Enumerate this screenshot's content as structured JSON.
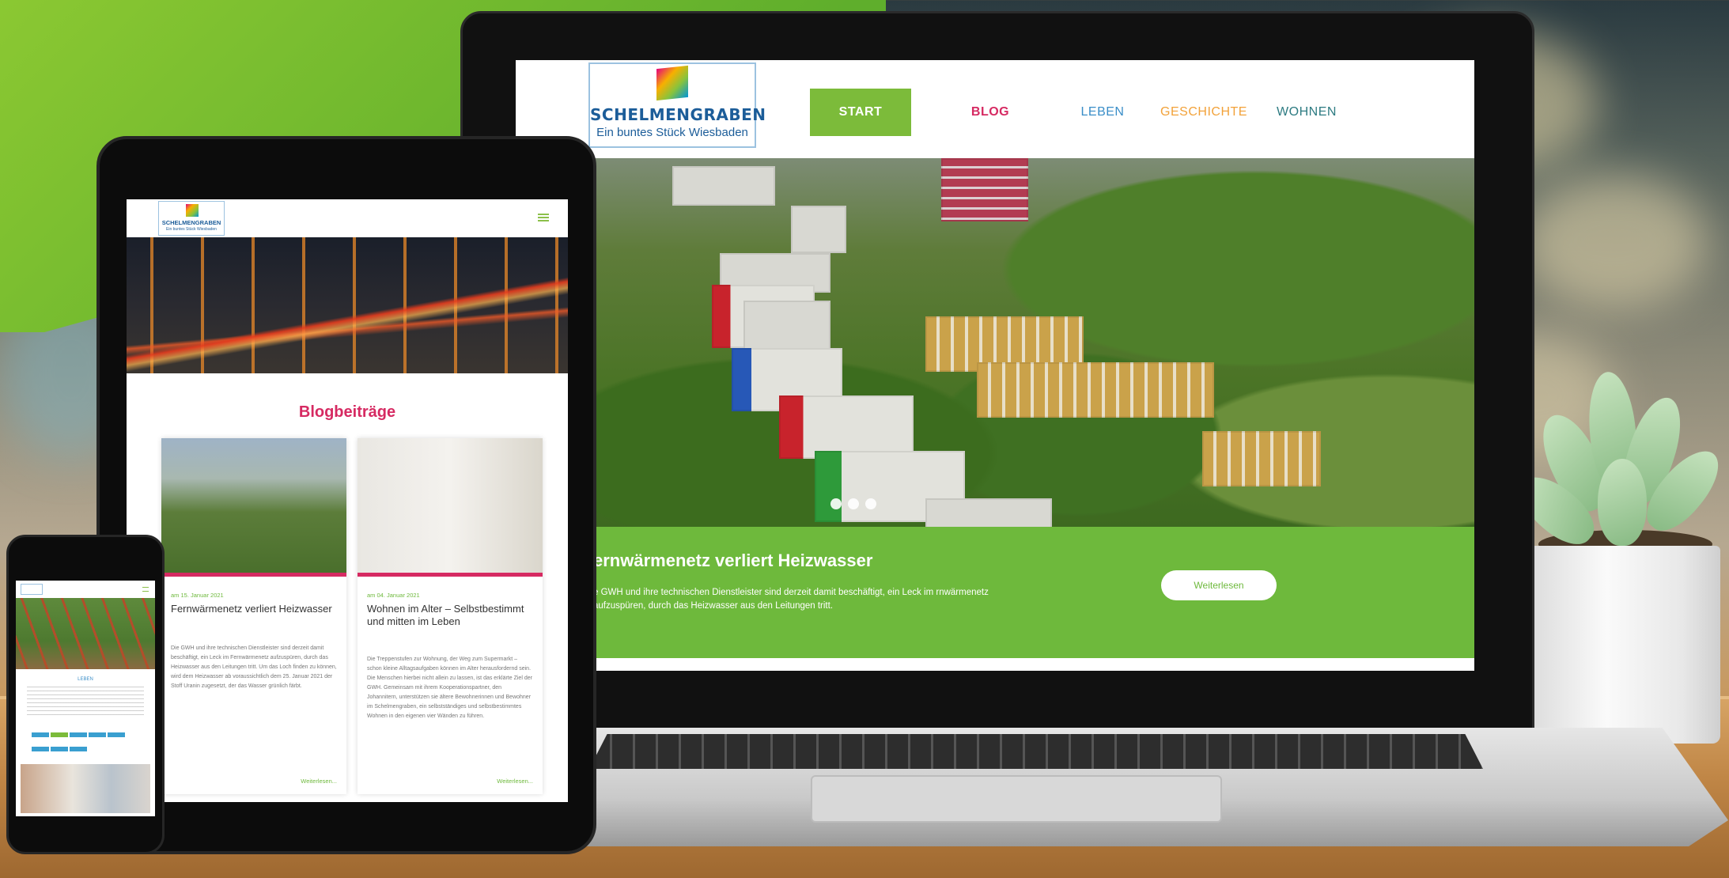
{
  "site": {
    "logo_title": "SCHELMENGRABEN",
    "logo_subtitle": "Ein buntes Stück Wiesbaden"
  },
  "nav": {
    "items": [
      {
        "label": "START",
        "color": "#7cbb3a"
      },
      {
        "label": "BLOG",
        "color": "#d62a62"
      },
      {
        "label": "LEBEN",
        "color": "#3a8ec8"
      },
      {
        "label": "GESCHICHTE",
        "color": "#f2a23a"
      },
      {
        "label": "WOHNEN",
        "color": "#2d7b82"
      }
    ]
  },
  "hero": {
    "title": "ernwärmenetz verliert Heizwasser",
    "text": "e GWH und ihre technischen Dienstleister sind derzeit damit beschäftigt, ein Leck im rnwärmenetz aufzuspüren, durch das Heizwasser aus den Leitungen tritt.",
    "button": "Weiterlesen"
  },
  "tablet": {
    "heading": "Blogbeiträge",
    "cards": [
      {
        "date": "am 15. Januar 2021",
        "title": "Fernwärmenetz verliert Heizwasser",
        "text": "Die GWH und ihre technischen Dienstleister sind derzeit damit beschäftigt, ein Leck im Fernwärmenetz aufzuspüren, durch das Heizwasser aus den Leitungen tritt. Um das Loch finden zu können, wird dem Heizwasser ab voraussichtlich dem 25. Januar 2021 der Stoff Uranin zugesetzt, der das Wasser grünlich färbt.",
        "more": "Weiterlesen..."
      },
      {
        "date": "am 04. Januar 2021",
        "title": "Wohnen im Alter – Selbstbestimmt und mitten im Leben",
        "text": "Die Treppenstufen zur Wohnung, der Weg zum Supermarkt – schon kleine Alltagsaufgaben können im Alter herausfordernd sein. Die Menschen hierbei nicht allein zu lassen, ist das erklärte Ziel der GWH. Gemeinsam mit ihrem Kooperationspartner, den Johannitern, unterstützen sie ältere Bewohnerinnen und Bewohner im Schelmengraben, ein selbstständiges und selbstbestimmtes Wohnen in den eigenen vier Wänden zu führen.",
        "more": "Weiterlesen..."
      }
    ]
  },
  "phone": {
    "heading": "LEBEN"
  },
  "colors": {
    "accent_green": "#6eb93c",
    "brand_pink": "#d62a62",
    "brand_blue": "#1c5d99"
  }
}
